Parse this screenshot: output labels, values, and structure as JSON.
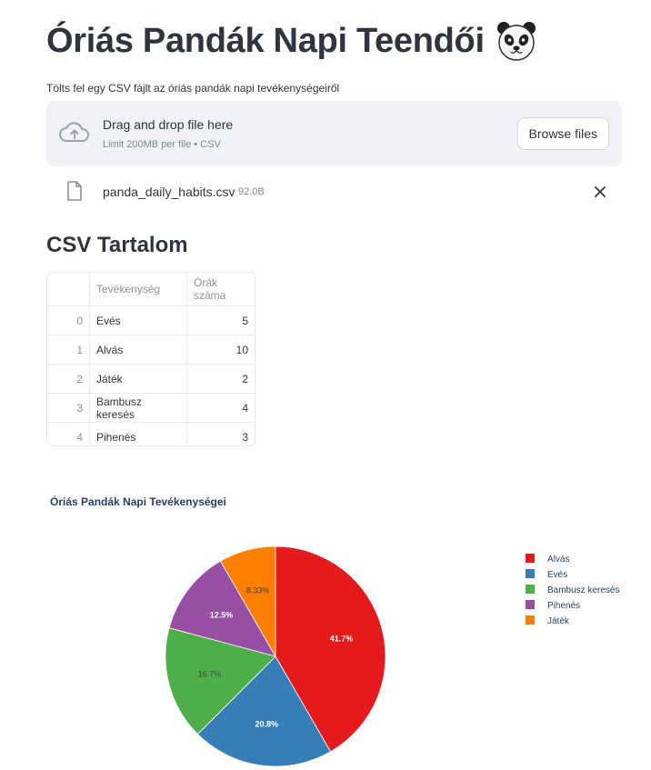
{
  "page": {
    "title": "Óriás Pandák Napi Teendői",
    "title_emoji_icon": "panda-face-icon",
    "caption": "Tölts fel egy CSV fájlt az óriás pandák napi tevékenységeiről"
  },
  "uploader": {
    "drag_text": "Drag and drop file here",
    "limit_text": "Limit 200MB per file • CSV",
    "browse_label": "Browse files",
    "icon": "cloud-upload-icon"
  },
  "uploaded_file": {
    "name": "panda_daily_habits.csv",
    "size": "92.0B",
    "icon": "file-icon",
    "remove_icon": "close-icon"
  },
  "table_section": {
    "heading": "CSV Tartalom",
    "columns": [
      "",
      "Tevékenység",
      "Órák száma"
    ],
    "rows": [
      {
        "index": "0",
        "activity": "Evés",
        "hours": "5"
      },
      {
        "index": "1",
        "activity": "Alvás",
        "hours": "10"
      },
      {
        "index": "2",
        "activity": "Játék",
        "hours": "2"
      },
      {
        "index": "3",
        "activity": "Bambusz keresés",
        "hours": "4"
      },
      {
        "index": "4",
        "activity": "Pihenés",
        "hours": "3"
      }
    ]
  },
  "chart_data": {
    "type": "pie",
    "title": "Óriás Pandák Napi Tevékenységei",
    "categories": [
      "Alvás",
      "Evés",
      "Bambusz keresés",
      "Pihenés",
      "Játék"
    ],
    "values": [
      10,
      5,
      4,
      3,
      2
    ],
    "labels": [
      "41.7%",
      "20.8%",
      "16.7%",
      "12.5%",
      "8.33%"
    ],
    "colors": [
      "#e41a1c",
      "#377eb8",
      "#4daf4a",
      "#984ea3",
      "#ff7f00"
    ],
    "label_colors": [
      "#ffffff",
      "#ffffff",
      "#444444",
      "#ffffff",
      "#444444"
    ],
    "legend_position": "right"
  }
}
